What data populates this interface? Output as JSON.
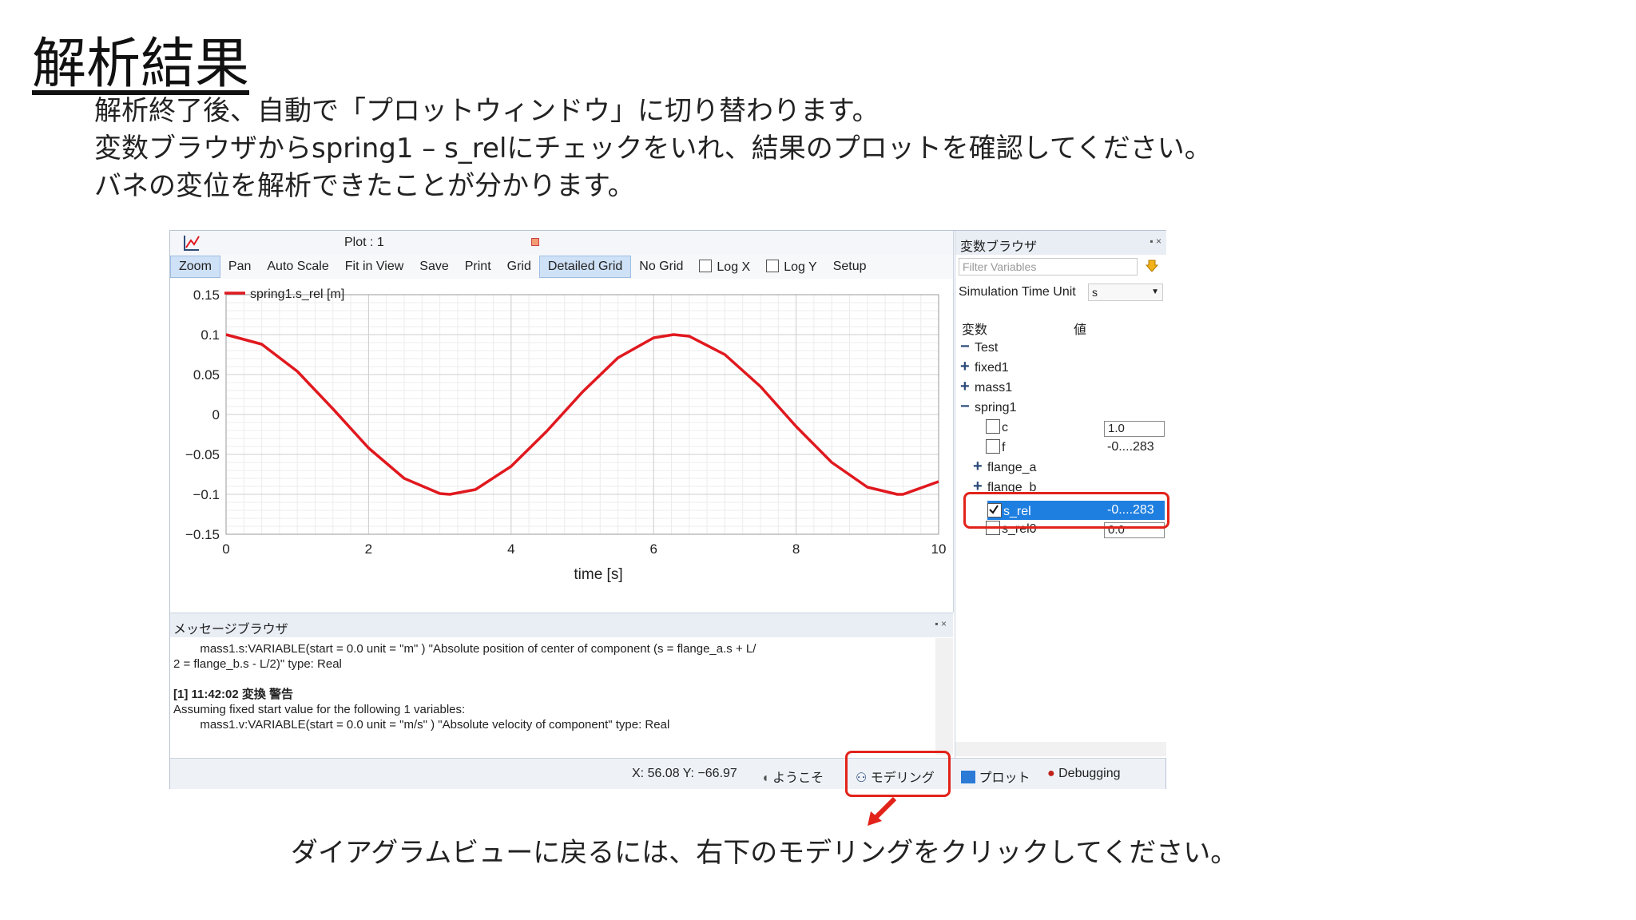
{
  "slide": {
    "title": "解析結果",
    "intro": [
      "解析終了後、自動で「プロットウィンドウ」に切り替わります。",
      "変数ブラウザからspring1 – s_relにチェックをいれ、結果のプロットを確認してください。",
      "バネの変位を解析できたことが分かります。"
    ],
    "bottom_note": "ダイアグラムビューに戻るには、右下のモデリングをクリックしてください。"
  },
  "plot": {
    "title": "Plot : 1",
    "toolbar": [
      {
        "label": "Zoom",
        "active": true
      },
      {
        "label": "Pan"
      },
      {
        "label": "Auto Scale"
      },
      {
        "label": "Fit in View"
      },
      {
        "label": "Save"
      },
      {
        "label": "Print"
      },
      {
        "label": "Grid"
      },
      {
        "label": "Detailed Grid",
        "active": true
      },
      {
        "label": "No Grid"
      },
      {
        "label": "Log X",
        "checkbox": true
      },
      {
        "label": "Log Y",
        "checkbox": true
      },
      {
        "label": "Setup"
      }
    ]
  },
  "chart_data": {
    "type": "line",
    "xlabel": "time [s]",
    "ylabel": "",
    "xlim": [
      0,
      10
    ],
    "ylim": [
      -0.15,
      0.15
    ],
    "x_ticks": [
      "0",
      "2",
      "4",
      "6",
      "8",
      "10"
    ],
    "y_ticks": [
      "0.15",
      "0.1",
      "0.05",
      "0",
      "−0.05",
      "−0.1",
      "−0.15"
    ],
    "grid": true,
    "legend_position": "top-left",
    "series": [
      {
        "name": "spring1.s_rel [m]",
        "color": "#e0191f",
        "x": [
          0,
          0.5,
          1,
          1.5,
          2,
          2.5,
          3,
          3.14,
          3.5,
          4,
          4.5,
          5,
          5.5,
          6,
          6.28,
          6.5,
          7,
          7.5,
          8,
          8.5,
          9,
          9.42,
          9.5,
          10
        ],
        "y": [
          0.1,
          0.088,
          0.054,
          0.007,
          -0.042,
          -0.08,
          -0.099,
          -0.1,
          -0.094,
          -0.065,
          -0.021,
          0.028,
          0.071,
          0.096,
          0.1,
          0.098,
          0.075,
          0.035,
          -0.015,
          -0.06,
          -0.091,
          -0.1,
          -0.1,
          -0.084
        ]
      }
    ]
  },
  "var_browser": {
    "title": "変数ブラウザ",
    "filter_placeholder": "Filter Variables",
    "time_unit_label": "Simulation Time Unit",
    "time_unit_value": "s",
    "col_var": "変数",
    "col_val": "値",
    "tree": [
      {
        "label": "Test",
        "exp": "−"
      },
      {
        "label": "fixed1",
        "exp": "+"
      },
      {
        "label": "mass1",
        "exp": "+"
      },
      {
        "label": "spring1",
        "exp": "−"
      },
      {
        "label": "c",
        "value": "1.0"
      },
      {
        "label": "f",
        "value": "-0....283"
      },
      {
        "label": "flange_a",
        "exp": "+"
      },
      {
        "label": "flange_b",
        "exp": "+"
      },
      {
        "label": "s_rel",
        "value": "-0....283"
      },
      {
        "label": "s_rel0",
        "value": "0.0"
      }
    ]
  },
  "messages": {
    "title": "メッセージブラウザ",
    "lines": [
      "        mass1.s:VARIABLE(start = 0.0 unit = \"m\" ) \"Absolute position of center of component (s = flange_a.s + L/",
      "2 = flange_b.s - L/2)\" type: Real",
      "",
      "[1] 11:42:02 変換 警告",
      "Assuming fixed start value for the following 1 variables:",
      "        mass1.v:VARIABLE(start = 0.0 unit = \"m/s\" ) \"Absolute velocity of component\" type: Real"
    ]
  },
  "status": {
    "coords": "X: 56.08 Y: −66.97",
    "tab_welcome": "ようこそ",
    "tab_modeling": "モデリング",
    "tab_plot": "プロット",
    "tab_debugging": "Debugging"
  }
}
